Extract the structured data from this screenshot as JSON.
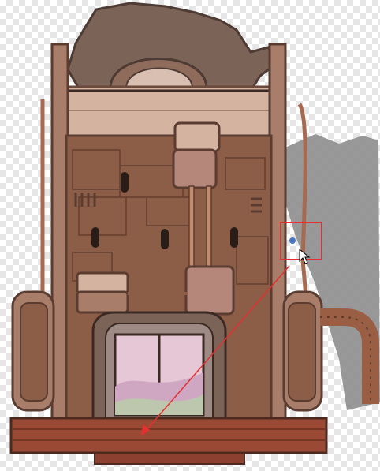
{
  "canvas": {
    "background": "transparency-checkerboard",
    "checker_color": "#e6e6e6"
  },
  "artwork": {
    "subject": "steampunk-tower-building",
    "colors": {
      "wall": "#8c5d47",
      "wall_dark": "#6e4636",
      "trim": "#a87d6a",
      "stone_light": "#d4b3a1",
      "roof_gear": "#7c6358",
      "pipe": "#9a5e45",
      "floor": "#9a4a34",
      "glass": "#e6c7d6",
      "shadow": "#8e8e8e"
    }
  },
  "selection": {
    "color": "#e53030"
  },
  "cursor": {
    "icon": "arrow-cursor-icon"
  }
}
